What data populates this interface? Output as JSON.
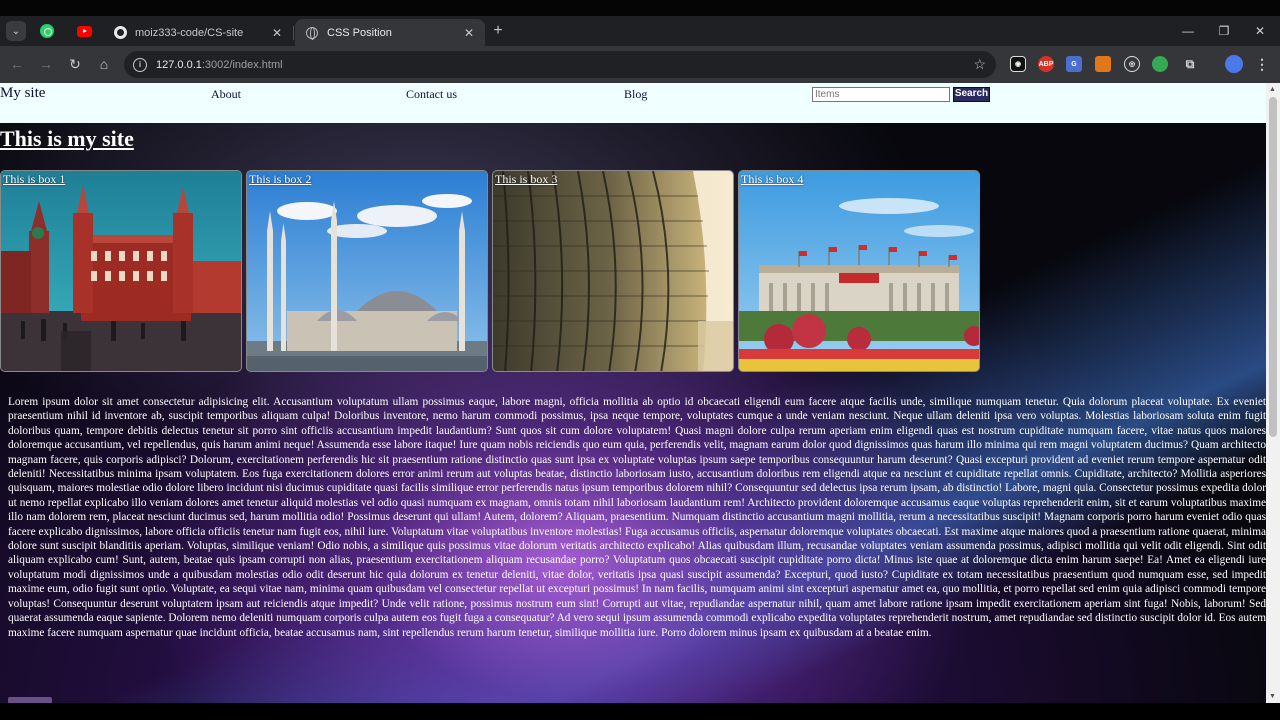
{
  "browser": {
    "tabs": [
      {
        "title": "moiz333-code/CS-site",
        "close": "✕"
      },
      {
        "title": "CSS Position",
        "close": "✕"
      }
    ],
    "new_tab": "+",
    "window_controls": {
      "minimize": "—",
      "maximize": "❐",
      "close": "✕"
    },
    "nav": {
      "back": "←",
      "forward": "→",
      "reload": "↻",
      "home": "⌂"
    },
    "url": {
      "host": "127.0.0.1",
      "path": ":3002/index.html"
    },
    "extensions": [
      {
        "name": "record-extension-icon",
        "text": "◉"
      },
      {
        "name": "adblock-plus-icon",
        "text": "ABP"
      },
      {
        "name": "translate-icon",
        "text": "G"
      },
      {
        "name": "metamask-icon",
        "text": ""
      },
      {
        "name": "circle-extension-icon",
        "text": "◎"
      },
      {
        "name": "green-extension-icon",
        "text": ""
      },
      {
        "name": "puzzle-icon",
        "text": "⧉"
      },
      {
        "name": "profile-avatar-icon",
        "text": ""
      },
      {
        "name": "chrome-menu-icon",
        "text": "⋮"
      }
    ]
  },
  "site": {
    "navbar": {
      "brand": "My site",
      "links": [
        "About",
        "Contact us",
        "Blog"
      ],
      "search_placeholder": "Items",
      "search_button": "Search"
    },
    "title": "This is my site",
    "boxes": [
      {
        "label": "This is box 1",
        "image": "red-square-moscow-photo"
      },
      {
        "label": "This is box 2",
        "image": "mosque-skyline-photo"
      },
      {
        "label": "This is box 3",
        "image": "glass-skyscraper-photo"
      },
      {
        "label": "This is box 4",
        "image": "great-hall-flowerbed-photo"
      }
    ],
    "paragraph": "Lorem ipsum dolor sit amet consectetur adipisicing elit. Accusantium voluptatum ullam possimus eaque, labore magni, officia mollitia ab optio id obcaecati eligendi eum facere atque facilis unde, similique numquam tenetur. Quia dolorum placeat voluptate. Ex eveniet praesentium nihil id inventore ab, suscipit temporibus aliquam culpa! Doloribus inventore, nemo harum commodi possimus, ipsa neque tempore, voluptates cumque a unde veniam nesciunt. Neque ullam deleniti ipsa vero voluptas. Molestias laboriosam soluta enim fugit doloribus quam, tempore debitis delectus tenetur sit porro sint officiis accusantium impedit laudantium? Sunt quos sit cum dolore voluptatem! Quasi magni dolore culpa rerum aperiam enim eligendi quas est nostrum cupiditate numquam facere, vitae natus quos maiores doloremque accusantium, vel repellendus, quis harum animi neque! Assumenda esse labore itaque! Iure quam nobis reiciendis quo eum quia, perferendis velit, magnam earum dolor quod dignissimos quas harum illo minima qui rem magni voluptatem ducimus? Quam architecto magnam facere, quis corporis adipisci? Dolorum, exercitationem perferendis hic sit praesentium ratione distinctio quas sunt ipsa ex voluptate voluptas ipsum saepe temporibus consequuntur harum deserunt? Quasi excepturi provident ad eveniet rerum tempore aspernatur odit deleniti! Necessitatibus minima ipsam voluptatem. Eos fuga exercitationem dolores error animi rerum aut voluptas beatae, distinctio laboriosam iusto, accusantium doloribus rem eligendi atque ea nesciunt et cupiditate repellat omnis. Cupiditate, architecto? Mollitia asperiores quisquam, maiores molestiae odio dolore libero incidunt nisi ducimus cupiditate quasi facilis similique error perferendis natus ipsum temporibus dolorem nihil? Consequuntur sed delectus ipsa rerum ipsam, ab distinctio! Labore, magni quia. Consectetur possimus expedita dolor ut nemo repellat explicabo illo veniam dolores amet tenetur aliquid molestias vel odio quasi numquam ex magnam, omnis totam nihil laboriosam laudantium rem! Architecto provident doloremque accusamus eaque voluptas reprehenderit enim, sit et earum voluptatibus maxime illo nam dolorem rem, placeat nesciunt ducimus sed, harum mollitia odio! Possimus deserunt qui ullam! Autem, dolorem? Aliquam, praesentium. Numquam distinctio accusantium magni mollitia, rerum a necessitatibus suscipit! Magnam corporis porro harum eveniet odio quas facere explicabo dignissimos, labore officia officiis tenetur nam fugit eos, nihil iure. Voluptatum vitae voluptatibus inventore molestias! Fuga accusamus officiis, aspernatur doloremque voluptates obcaecati. Est maxime atque maiores quod a praesentium ratione quaerat, minima dolore sunt suscipit blanditiis aperiam. Voluptas, similique veniam! Odio nobis, a similique quis possimus vitae dolorum veritatis architecto explicabo! Alias quibusdam illum, recusandae voluptates veniam assumenda possimus, adipisci mollitia qui velit odit eligendi. Sint odit aliquam explicabo cum! Sunt, autem, beatae quis ipsam corrupti non alias, praesentium exercitationem aliquam recusandae porro? Voluptatum quos obcaecati suscipit cupiditate porro dicta! Minus iste quae at doloremque dicta enim harum saepe! Ea! Amet ea eligendi iure voluptatum modi dignissimos unde a quibusdam molestias odio odit deserunt hic quia dolorum ex tenetur deleniti, vitae dolor, veritatis ipsa quasi suscipit assumenda? Excepturi, quod iusto? Cupiditate ex totam necessitatibus praesentium quod numquam esse, sed impedit maxime eum, odio fugit sunt optio. Voluptate, ea sequi vitae nam, minima quam quibusdam vel consectetur repellat ut excepturi possimus! In nam facilis, numquam animi sint excepturi aspernatur amet ea, quo mollitia, et porro repellat sed enim quia adipisci commodi tempore voluptas! Consequuntur deserunt voluptatem ipsam aut reiciendis atque impedit? Unde velit ratione, possimus nostrum eum sint! Corrupti aut vitae, repudiandae aspernatur nihil, quam amet labore ratione ipsam impedit exercitationem aperiam sint fuga! Nobis, laborum! Sed quaerat assumenda eaque sapiente. Dolorem nemo deleniti numquam corporis culpa autem eos fugit fuga a consequatur? Ad vero sequi ipsum assumenda commodi explicabo expedita voluptates reprehenderit nostrum, amet repudiandae sed distinctio suscipit dolor id. Eos autem maxime facere numquam aspernatur quae incidunt officia, beatae accusamus nam, sint repellendus rerum harum tenetur, similique mollitia iure. Porro dolorem minus ipsam ex quibusdam at a beatae enim."
  }
}
